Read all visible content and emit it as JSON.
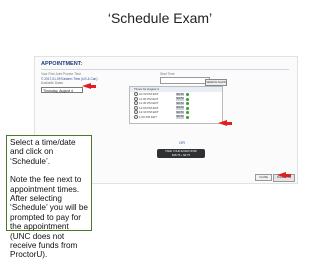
{
  "slide": {
    "title": "‘Schedule Exam’"
  },
  "screenshot": {
    "section_title": "APPOINTMENT:",
    "left_lines": [
      "Your First Joint Proctor Time",
      "© 2017-01-09 Eastern Time (US & Can)",
      "Available Dates"
    ],
    "date_value": "Thursday, August 4",
    "right_field_label": "Start Time",
    "search_button": "SEARCH AGAIN",
    "times_header": "Times for August 4",
    "slots": [
      {
        "time": "10:30 PM EDT",
        "fee": "$20.50"
      },
      {
        "time": "11:00 PM EDT",
        "fee": "$20.50"
      },
      {
        "time": "11:30 PM EDT",
        "fee": "$20.50"
      },
      {
        "time": "12:00 PM EDT",
        "fee": "$20.50"
      },
      {
        "time": "12:30 PM EDT",
        "fee": "$20.50"
      },
      {
        "time": "1:00 PM EDT",
        "fee": "$20.50"
      }
    ],
    "or_text": "OR",
    "take_now_line1": "TAKE YOUR EXAM NOW!",
    "take_now_line2": "$48.75 + $0.75",
    "cancel_label": "CLOSE",
    "schedule_label": "SCHEDULE"
  },
  "callout": {
    "para1": "Select a time/date and click on ‘Schedule’.",
    "para2": "Note the fee next to appointment times. After selecting ‘Schedule’ you will be prompted to pay for the appointment (UNC does not receive funds from ProctorU)."
  },
  "colors": {
    "arrow": "#e02020",
    "callout_border": "#4a7a28",
    "section_title": "#1f3b7a"
  }
}
